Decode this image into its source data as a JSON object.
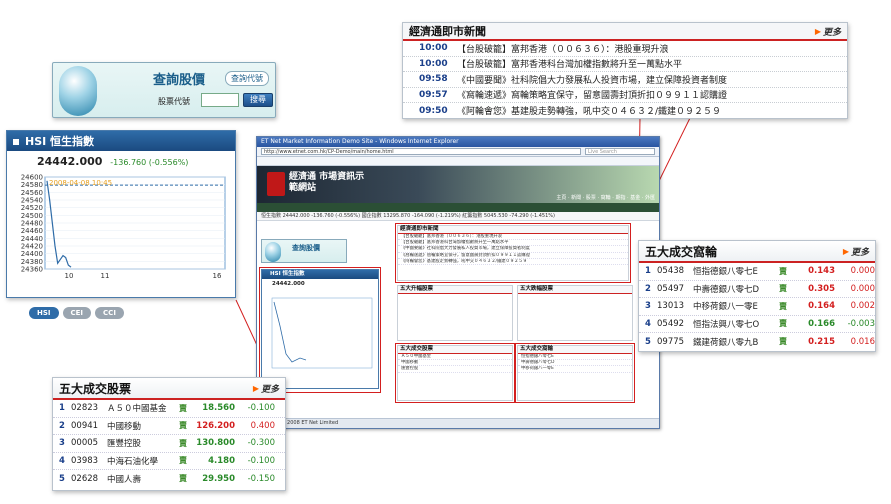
{
  "news": {
    "title": "經濟通即市新聞",
    "more": "更多",
    "items": [
      {
        "time": "10:00",
        "text": "【台股破籠】富邦香港（００６３６）：港股重現升浪"
      },
      {
        "time": "10:00",
        "text": "【台股破籠】富邦香港科台灣加權指數將升至一萬點水平"
      },
      {
        "time": "09:58",
        "text": "《中國要聞》社科院倡大力發展私人投資市場，建立保障投資者制度"
      },
      {
        "time": "09:57",
        "text": "《窩輪速遞》窩輪策略宜保守，留意國壽封頂折扣０９９１１認購證"
      },
      {
        "time": "09:50",
        "text": "《阿輪會您》基建股走勢轉強，吼中交０４６３２/鐵建０９２５９"
      }
    ]
  },
  "query": {
    "title": "查詢股價",
    "code_link": "查詢代號",
    "label": "股票代號",
    "input_value": "",
    "button": "搜尋"
  },
  "hsi": {
    "title": "HSI 恒生指數",
    "value": "24442.000",
    "change": "-136.760 (-0.556%)",
    "tabs": [
      "HSI",
      "CEI",
      "CCI"
    ],
    "chart_data": {
      "type": "line",
      "title": "2008-04-08 10:45",
      "x_ticks": [
        "10",
        "11",
        "16"
      ],
      "y_ticks": [
        "24600",
        "24580",
        "24560",
        "24540",
        "24520",
        "24500",
        "24480",
        "24460",
        "24440",
        "24420",
        "24400",
        "24380",
        "24360"
      ],
      "ylim": [
        24360,
        24600
      ],
      "reference": 24578.76,
      "series": [
        {
          "values": [
            24590,
            24540,
            24480,
            24420,
            24375,
            24385,
            24395,
            24390,
            24370,
            24365
          ]
        }
      ]
    }
  },
  "stocks": {
    "title": "五大成交股票",
    "more": "更多",
    "rows": [
      {
        "rank": "1",
        "code": "02823",
        "name": "Ａ５０中國基金",
        "flag": "賣",
        "price": "18.560",
        "change": "-0.100"
      },
      {
        "rank": "2",
        "code": "00941",
        "name": "中國移動",
        "flag": "賣",
        "price": "126.200",
        "change": "0.400"
      },
      {
        "rank": "3",
        "code": "00005",
        "name": "匯豐控股",
        "flag": "賣",
        "price": "130.800",
        "change": "-0.300"
      },
      {
        "rank": "4",
        "code": "03983",
        "name": "中海石油化學",
        "flag": "賣",
        "price": "4.180",
        "change": "-0.100"
      },
      {
        "rank": "5",
        "code": "02628",
        "name": "中國人壽",
        "flag": "賣",
        "price": "29.950",
        "change": "-0.150"
      }
    ]
  },
  "warrants": {
    "title": "五大成交窩輪",
    "more": "更多",
    "rows": [
      {
        "rank": "1",
        "code": "05438",
        "name": "恒指德銀八零七E",
        "flag": "賣",
        "price": "0.143",
        "change": "0.000"
      },
      {
        "rank": "2",
        "code": "05497",
        "name": "中壽德銀八零七D",
        "flag": "賣",
        "price": "0.305",
        "change": "0.000"
      },
      {
        "rank": "3",
        "code": "13013",
        "name": "中移荷銀八一零E",
        "flag": "賣",
        "price": "0.164",
        "change": "0.002"
      },
      {
        "rank": "4",
        "code": "05492",
        "name": "恒指法興八零七O",
        "flag": "賣",
        "price": "0.166",
        "change": "-0.003"
      },
      {
        "rank": "5",
        "code": "09775",
        "name": "鐵建荷銀八零九B",
        "flag": "賣",
        "price": "0.215",
        "change": "0.016"
      }
    ]
  },
  "browser": {
    "title": "ET Net Market Information Demo Site - Windows Internet Explorer",
    "url": "http://www.etnet.com.hk/CP-Demo/main/home.html",
    "search": "Live Search",
    "logo": "經濟通 市場資訊示範網站",
    "nav": "主頁 · 新聞 · 股票 · 窩輪 · 期指 · 基金 · 外匯",
    "ticker": "恒生指數 24442.000 -136.760 (-0.556%)   國企指數 13295.870 -164.090 (-1.219%)   紅籌指數 5045.530 -74.290 (-1.451%)",
    "status": "Copyright 2008 ET Net Limited",
    "panel_news": "經濟通即市新聞",
    "panel_top_gain": "五大升幅股票",
    "panel_top_loss": "五大跌幅股票",
    "panel_top_stock": "五大成交股票",
    "panel_top_warrant": "五大成交窩輪"
  },
  "colors": {
    "accent_red": "#d31f1f",
    "up": "#d31f1f",
    "down": "#2a8a2a",
    "hsi_blue": "#2f6ca8"
  }
}
